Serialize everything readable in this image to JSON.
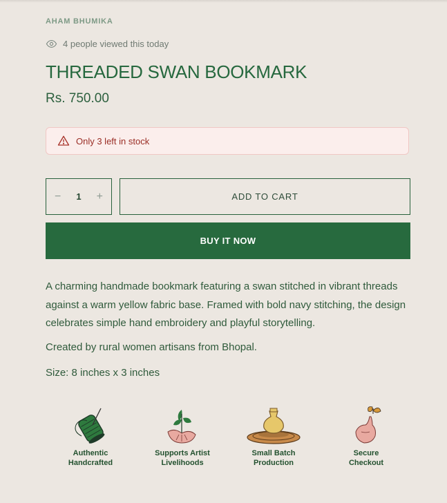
{
  "product": {
    "vendor": "AHAM BHUMIKA",
    "viewers_text": "4 people viewed this today",
    "title": "THREADED SWAN BOOKMARK",
    "price": "Rs. 750.00",
    "stock_text": "Only 3 left in stock",
    "quantity": "1",
    "minus_symbol": "−",
    "plus_symbol": "+",
    "add_to_cart_label": "ADD TO CART",
    "buy_now_label": "BUY IT NOW",
    "description": "A charming handmade bookmark featuring a swan stitched in vibrant threads against a warm yellow fabric base. Framed with bold navy stitching, the design celebrates simple hand embroidery and playful storytelling.",
    "artisans": "Created by rural women artisans from Bhopal.",
    "size": "Size: 8 inches x 3 inches"
  },
  "features": [
    {
      "line1": "Authentic",
      "line2": "Handcrafted",
      "icon": "thread-spool-icon"
    },
    {
      "line1": "Supports Artist",
      "line2": "Livelihoods",
      "icon": "hand-sapling-icon"
    },
    {
      "line1": "Small Batch",
      "line2": "Production",
      "icon": "pottery-wheel-icon"
    },
    {
      "line1": "Secure",
      "line2": "Checkout",
      "icon": "hand-butterfly-icon"
    }
  ],
  "colors": {
    "background": "#ece7e1",
    "brand_green": "#276a3e",
    "stock_bg": "#fbeeec",
    "stock_text": "#9a2d25"
  }
}
